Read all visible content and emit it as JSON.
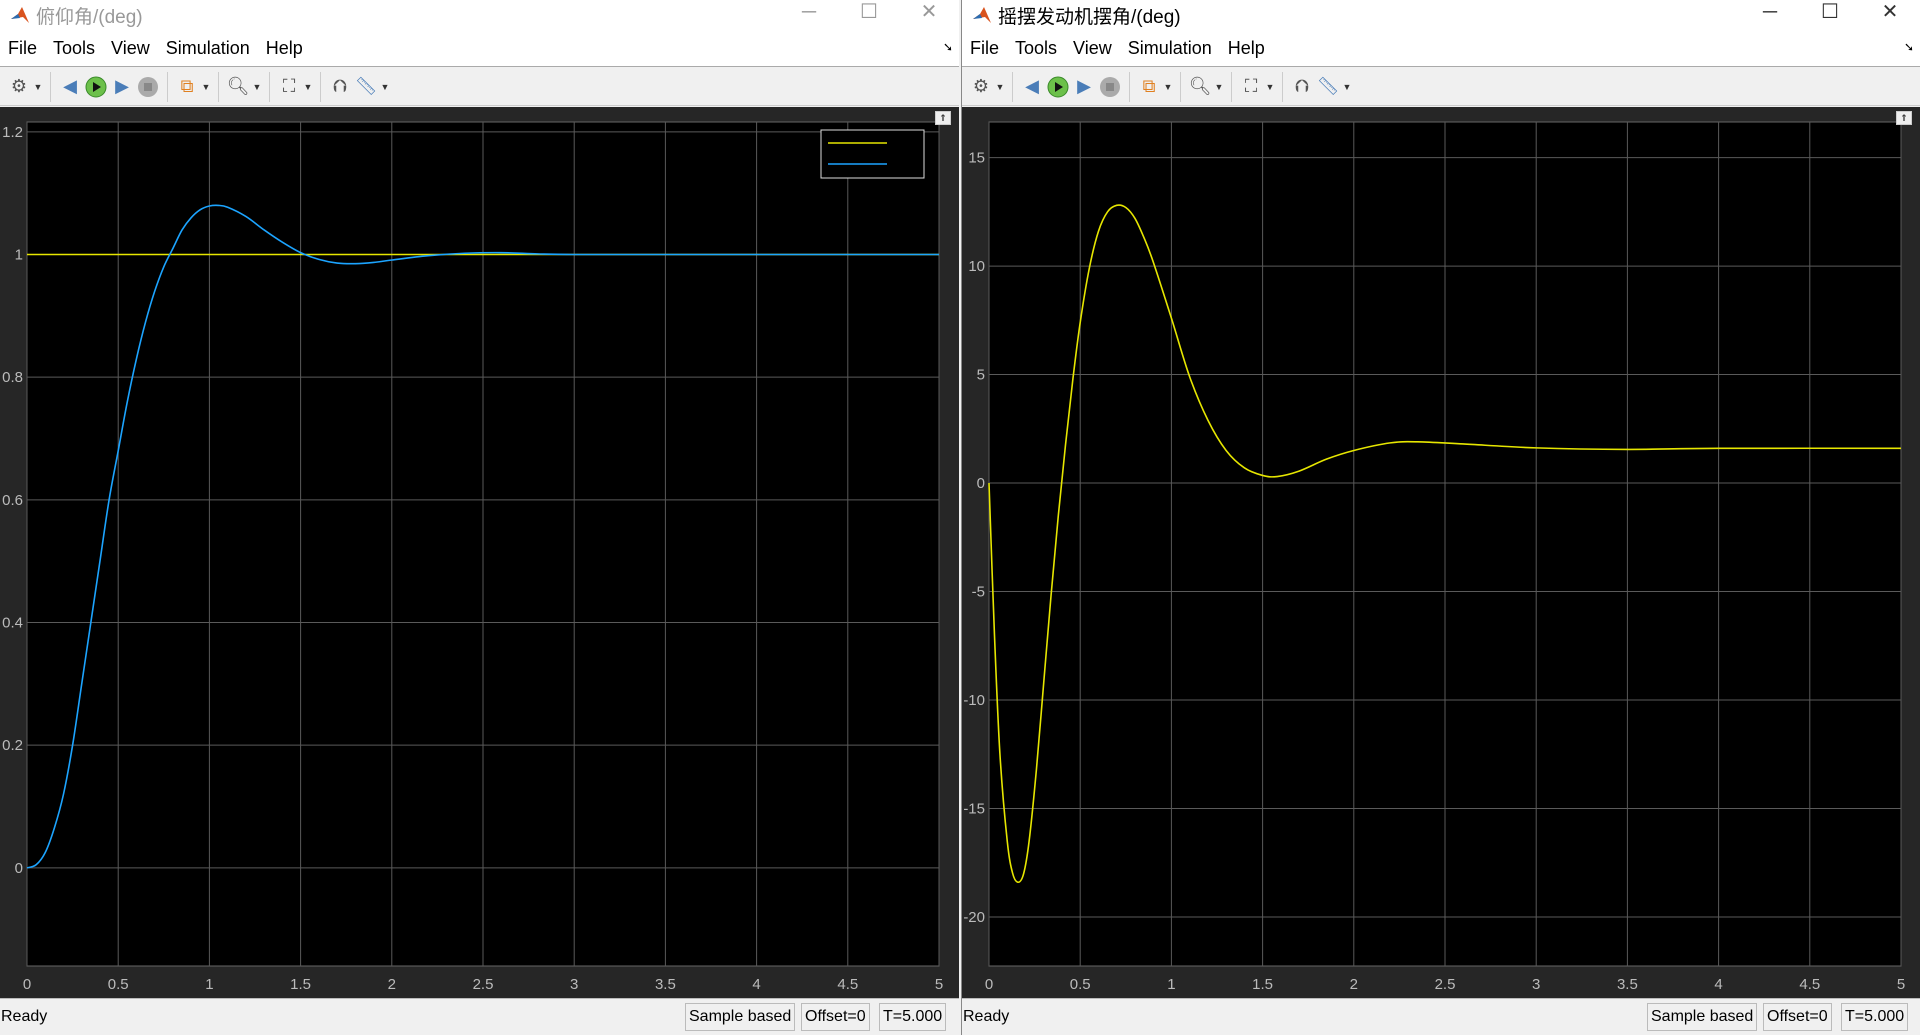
{
  "windows": [
    {
      "title": "俯仰角/(deg)",
      "menu": [
        "File",
        "Tools",
        "View",
        "Simulation",
        "Help"
      ],
      "status": {
        "ready": "Ready",
        "sample": "Sample based",
        "offset": "Offset=0",
        "time": "T=5.000"
      }
    },
    {
      "title": "摇摆发动机摆角/(deg)",
      "menu": [
        "File",
        "Tools",
        "View",
        "Simulation",
        "Help"
      ],
      "status": {
        "ready": "Ready",
        "sample": "Sample based",
        "offset": "Offset=0",
        "time": "T=5.000"
      }
    }
  ],
  "toolbar_icons": [
    "settings-icon",
    "step-back-icon",
    "run-icon",
    "step-forward-icon",
    "stop-icon",
    "signal-hierarchy-icon",
    "zoom-icon",
    "fit-to-view-icon",
    "trigger-icon",
    "measure-icon"
  ],
  "chart_data": [
    {
      "type": "line",
      "xlim": [
        0,
        5
      ],
      "ylim": [
        -0.16,
        1.216
      ],
      "grid": true,
      "legend": "top-right",
      "xticks": [
        0,
        0.5,
        1,
        1.5,
        2,
        2.5,
        3,
        3.5,
        4,
        4.5,
        5
      ],
      "yticks": [
        0,
        0.2,
        0.4,
        0.6,
        0.8,
        1,
        1.2
      ],
      "series": [
        {
          "color": "#e6e600",
          "x": [
            0,
            5
          ],
          "y": [
            1,
            1
          ]
        },
        {
          "color": "#1ca4ff",
          "x": [
            0,
            0.05,
            0.1,
            0.15,
            0.2,
            0.25,
            0.3,
            0.35,
            0.4,
            0.45,
            0.5,
            0.55,
            0.6,
            0.65,
            0.7,
            0.75,
            0.8,
            0.85,
            0.9,
            0.95,
            1.0,
            1.05,
            1.1,
            1.2,
            1.3,
            1.4,
            1.5,
            1.6,
            1.7,
            1.8,
            1.9,
            2.0,
            2.2,
            2.4,
            2.6,
            2.8,
            3.0,
            3.5,
            4.0,
            5.0
          ],
          "y": [
            0,
            0.005,
            0.025,
            0.065,
            0.12,
            0.2,
            0.3,
            0.4,
            0.5,
            0.6,
            0.68,
            0.76,
            0.83,
            0.89,
            0.94,
            0.98,
            1.01,
            1.04,
            1.06,
            1.073,
            1.079,
            1.08,
            1.077,
            1.062,
            1.04,
            1.02,
            1.003,
            0.992,
            0.986,
            0.985,
            0.987,
            0.991,
            0.998,
            1.002,
            1.003,
            1.001,
            1.0,
            1.0,
            1.0,
            1.0
          ]
        }
      ]
    },
    {
      "type": "line",
      "xlim": [
        0,
        5
      ],
      "ylim": [
        -22.26,
        16.64
      ],
      "grid": true,
      "xticks": [
        0,
        0.5,
        1,
        1.5,
        2,
        2.5,
        3,
        3.5,
        4,
        4.5,
        5
      ],
      "yticks": [
        -20,
        -15,
        -10,
        -5,
        0,
        5,
        10,
        15
      ],
      "series": [
        {
          "color": "#e6e600",
          "x": [
            0,
            0.03,
            0.06,
            0.1,
            0.13,
            0.16,
            0.19,
            0.22,
            0.26,
            0.3,
            0.34,
            0.38,
            0.42,
            0.46,
            0.5,
            0.55,
            0.6,
            0.65,
            0.7,
            0.75,
            0.8,
            0.85,
            0.9,
            1.0,
            1.1,
            1.2,
            1.3,
            1.4,
            1.5,
            1.58,
            1.7,
            1.85,
            2.0,
            2.2,
            2.35,
            2.6,
            3.0,
            3.5,
            4.0,
            5.0
          ],
          "y": [
            0,
            -7,
            -12.5,
            -16.5,
            -18.0,
            -18.4,
            -18.0,
            -16.5,
            -13.2,
            -9.2,
            -5.2,
            -1.5,
            1.8,
            4.8,
            7.4,
            9.9,
            11.6,
            12.5,
            12.8,
            12.7,
            12.2,
            11.3,
            10.2,
            7.6,
            4.9,
            2.9,
            1.5,
            0.7,
            0.35,
            0.3,
            0.55,
            1.1,
            1.5,
            1.85,
            1.9,
            1.8,
            1.62,
            1.55,
            1.6,
            1.6
          ]
        }
      ]
    }
  ]
}
